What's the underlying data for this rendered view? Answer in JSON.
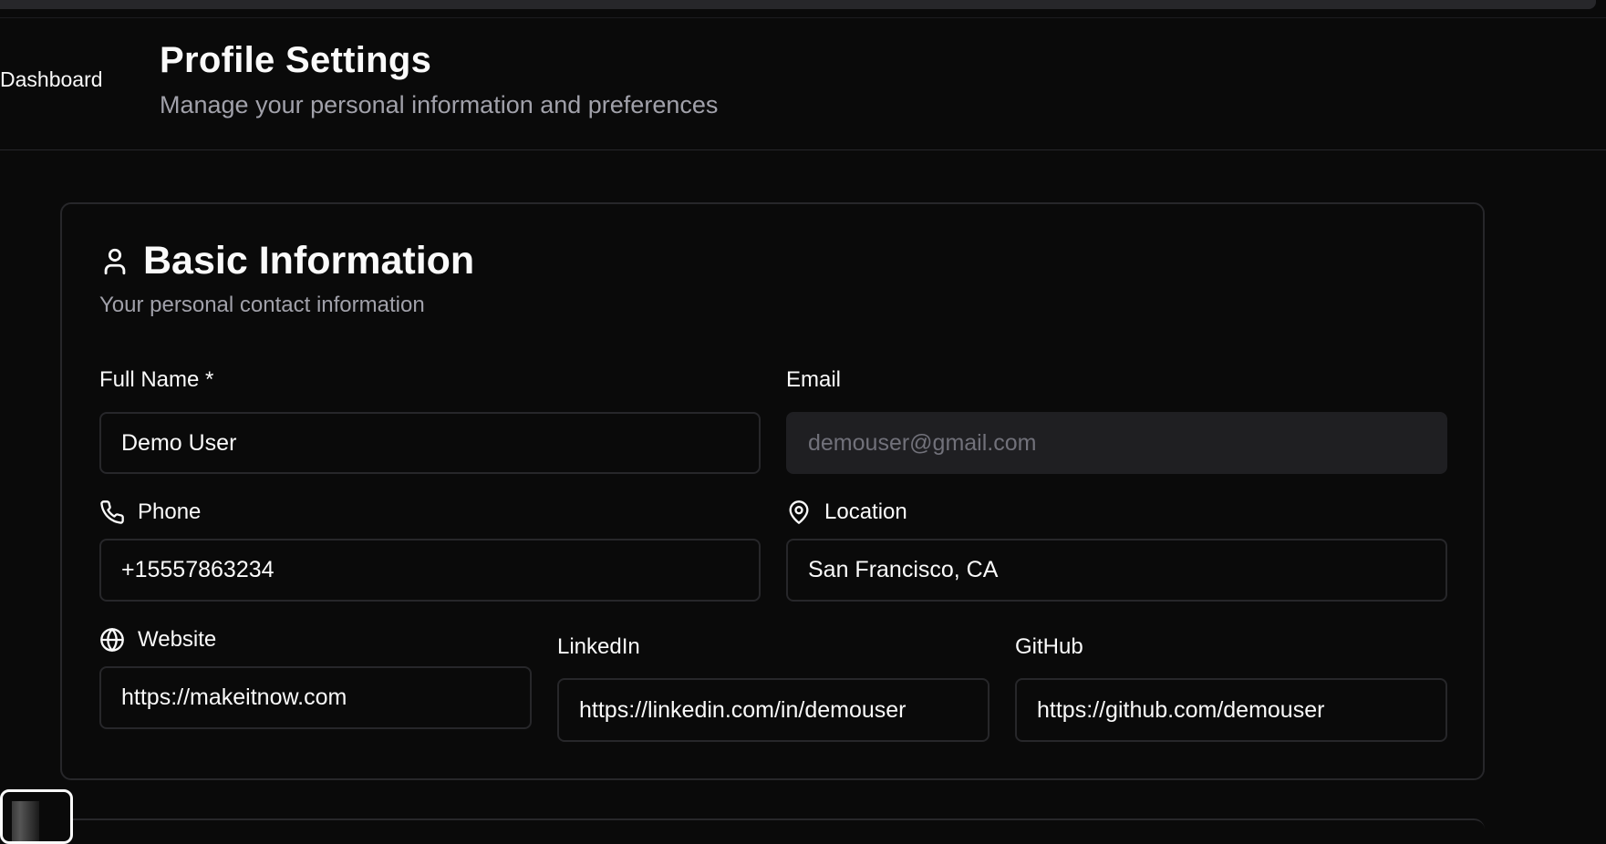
{
  "nav": {
    "dashboard_label": "Dashboard"
  },
  "header": {
    "title": "Profile Settings",
    "subtitle": "Manage your personal information and preferences"
  },
  "basic_info": {
    "title": "Basic Information",
    "description": "Your personal contact information",
    "icon": "user-icon",
    "fields": {
      "full_name": {
        "label": "Full Name *",
        "value": "Demo User"
      },
      "email": {
        "label": "Email",
        "value": "demouser@gmail.com",
        "disabled": true
      },
      "phone": {
        "label": "Phone",
        "value": "+15557863234",
        "icon": "phone-icon"
      },
      "location": {
        "label": "Location",
        "value": "San Francisco, CA",
        "icon": "map-pin-icon"
      },
      "website": {
        "label": "Website",
        "value": "https://makeitnow.com",
        "icon": "globe-icon"
      },
      "linkedin": {
        "label": "LinkedIn",
        "value": "https://linkedin.com/in/demouser"
      },
      "github": {
        "label": "GitHub",
        "value": "https://github.com/demouser"
      }
    }
  },
  "colors": {
    "background": "#0a0a0a",
    "border": "#27272a",
    "text": "#fafafa",
    "muted": "#a1a1aa",
    "disabled_bg": "#1f1f22"
  }
}
